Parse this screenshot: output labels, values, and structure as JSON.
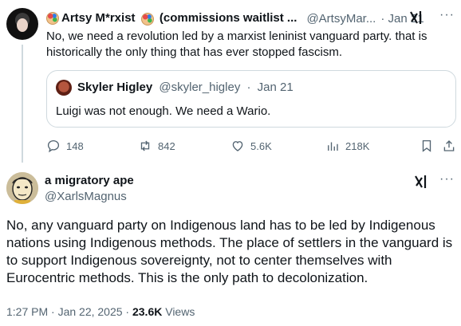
{
  "reply": {
    "author_name": "Artsy M*rxist",
    "author_name_suffix": "(commissions waitlist ...",
    "author_handle": "@ArtsyMar...",
    "date": "Jan 21",
    "name_emoji": "artist-palette",
    "text": "No, we need a revolution led by a marxist leninist vanguard party. that is historically the only thing that has ever stopped fascism.",
    "quote": {
      "author_name": "Skyler Higley",
      "author_handle": "@skyler_higley",
      "date": "Jan 21",
      "text": "Luigi was not enough. We need a Wario."
    },
    "actions": {
      "replies": "148",
      "reposts": "842",
      "likes": "5.6K",
      "views": "218K"
    }
  },
  "main_post": {
    "author_name": "a migratory ape",
    "author_handle": "@XarlsMagnus",
    "text": "No, any vanguard party on Indigenous land has to be led by Indigenous nations using Indigenous methods. The place of settlers in the vanguard is to support Indigenous sovereignty, not to center themselves with Eurocentric methods. This is the only path to decolonization.",
    "timestamp": "1:27 PM · Jan 22, 2025 ·",
    "views_count": "23.6K",
    "views_label": "Views"
  },
  "ui": {
    "more_glyph": "···",
    "separator": "·"
  },
  "colors": {
    "text": "#0f1419",
    "secondary": "#536471",
    "border": "#cfd9de"
  }
}
